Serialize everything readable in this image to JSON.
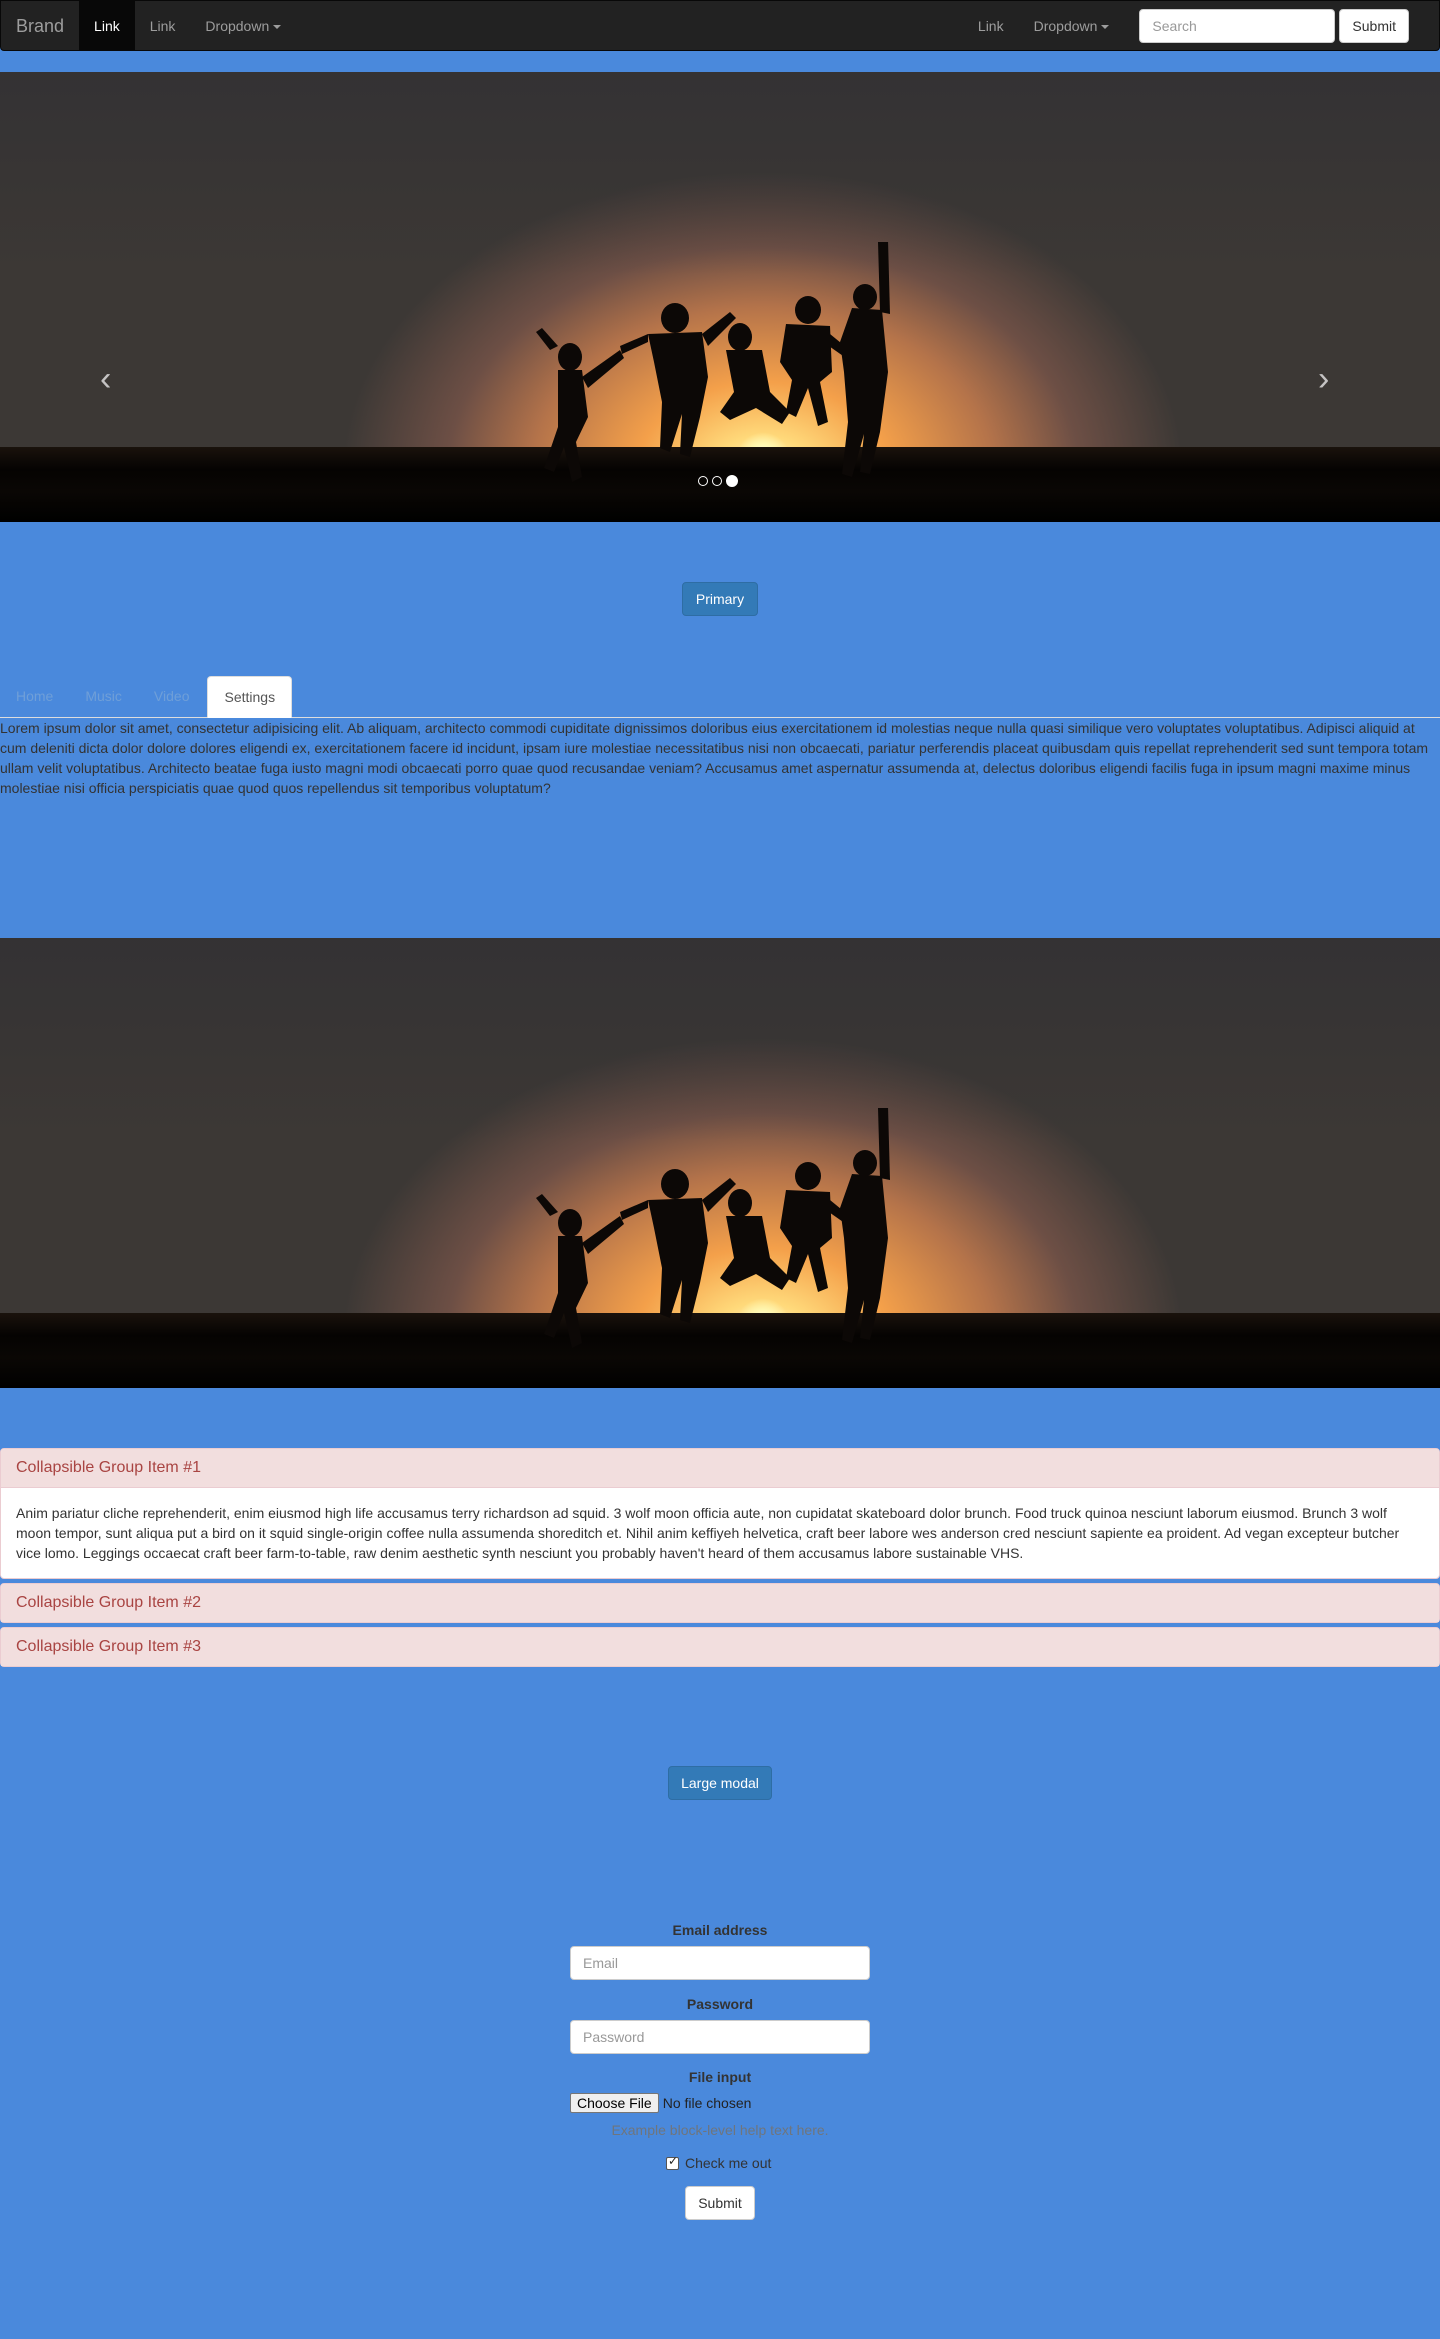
{
  "navbar": {
    "brand": "Brand",
    "links": [
      "Link",
      "Link"
    ],
    "dropdown_label": "Dropdown",
    "right_link": "Link",
    "right_dropdown": "Dropdown",
    "search_placeholder": "Search",
    "submit_label": "Submit"
  },
  "carousel": {
    "prev_glyph": "‹",
    "next_glyph": "›",
    "indicator_count": 3,
    "active_indicator": 3
  },
  "primary_button": "Primary",
  "tabs": {
    "items": [
      "Home",
      "Music",
      "Video",
      "Settings"
    ],
    "active": "Settings",
    "content": "Lorem ipsum dolor sit amet, consectetur adipisicing elit. Ab aliquam, architecto commodi cupiditate dignissimos doloribus eius exercitationem id molestias neque nulla quasi similique vero voluptates voluptatibus. Adipisci aliquid at cum deleniti dicta dolor dolore dolores eligendi ex, exercitationem facere id incidunt, ipsam iure molestiae necessitatibus nisi non obcaecati, pariatur perferendis placeat quibusdam quis repellat reprehenderit sed sunt tempora totam ullam velit voluptatibus. Architecto beatae fuga iusto magni modi obcaecati porro quae quod recusandae veniam? Accusamus amet aspernatur assumenda at, delectus doloribus eligendi facilis fuga in ipsum magni maxime minus molestiae nisi officia perspiciatis quae quod quos repellendus sit temporibus voluptatum?"
  },
  "accordion": {
    "items": [
      {
        "title": "Collapsible Group Item #1",
        "body": "Anim pariatur cliche reprehenderit, enim eiusmod high life accusamus terry richardson ad squid. 3 wolf moon officia aute, non cupidatat skateboard dolor brunch. Food truck quinoa nesciunt laborum eiusmod. Brunch 3 wolf moon tempor, sunt aliqua put a bird on it squid single-origin coffee nulla assumenda shoreditch et. Nihil anim keffiyeh helvetica, craft beer labore wes anderson cred nesciunt sapiente ea proident. Ad vegan excepteur butcher vice lomo. Leggings occaecat craft beer farm-to-table, raw denim aesthetic synth nesciunt you probably haven't heard of them accusamus labore sustainable VHS."
      },
      {
        "title": "Collapsible Group Item #2"
      },
      {
        "title": "Collapsible Group Item #3"
      }
    ]
  },
  "modal_button": "Large modal",
  "form": {
    "email_label": "Email address",
    "email_placeholder": "Email",
    "password_label": "Password",
    "password_placeholder": "Password",
    "file_label": "File input",
    "file_button": "Choose File",
    "file_status": "No file chosen",
    "help_text": "Example block-level help text here.",
    "checkbox_label": "Check me out",
    "checkbox_checked": true,
    "submit_label": "Submit"
  },
  "colors": {
    "page_background": "#4a89dc",
    "navbar": "#222222",
    "primary": "#337ab7",
    "panel_heading": "#f2dede",
    "panel_text": "#a94442"
  }
}
